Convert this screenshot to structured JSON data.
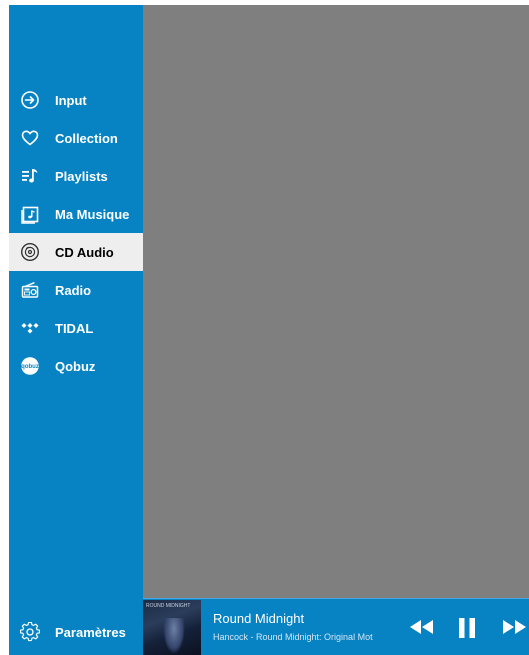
{
  "nav": {
    "items": [
      {
        "label": "Input",
        "icon": "input-arrow-icon",
        "active": false
      },
      {
        "label": "Collection",
        "icon": "heart-icon",
        "active": false
      },
      {
        "label": "Playlists",
        "icon": "playlist-icon",
        "active": false
      },
      {
        "label": "Ma Musique",
        "icon": "music-folder-icon",
        "active": false
      },
      {
        "label": "CD Audio",
        "icon": "cd-icon",
        "active": true
      },
      {
        "label": "Radio",
        "icon": "radio-icon",
        "active": false
      },
      {
        "label": "TIDAL",
        "icon": "tidal-icon",
        "active": false
      },
      {
        "label": "Qobuz",
        "icon": "qobuz-icon",
        "active": false
      }
    ],
    "settings_label": "Paramètres"
  },
  "player": {
    "title": "Round Midnight",
    "subtitle": "Hancock - Round Midnight: Original Mot",
    "album_art_text": "ROUND MIDNIGHT"
  },
  "colors": {
    "sidebar": "#0783c4",
    "active_item_bg": "#eeeeee",
    "main_bg": "#7f7f7f"
  }
}
